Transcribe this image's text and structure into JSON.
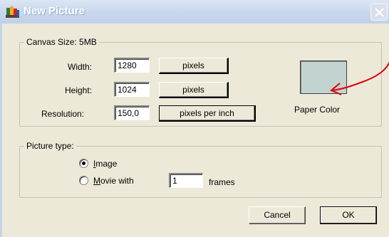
{
  "window": {
    "title": "New Picture",
    "icon": "paint-palette-icon"
  },
  "canvas_size": {
    "legend": "Canvas Size: 5MB",
    "width_label": "Width:",
    "width_value": "1280",
    "width_unit": "pixels",
    "height_label": "Height:",
    "height_value": "1024",
    "height_unit": "pixels",
    "resolution_label": "Resolution:",
    "resolution_value": "150,0",
    "resolution_unit": "pixels per inch",
    "paper_color_label": "Paper Color",
    "paper_color": "#C3D3D0",
    "annotation_arrow_color": "#E00000"
  },
  "picture_type": {
    "legend": "Picture type:",
    "image_prefix": "",
    "image_hotkey": "I",
    "image_rest": "mage",
    "image_selected": true,
    "movie_hotkey": "M",
    "movie_rest": "ovie with",
    "movie_selected": false,
    "frames_value": "1",
    "frames_label": "frames"
  },
  "buttons": {
    "cancel": "Cancel",
    "ok": "OK"
  }
}
